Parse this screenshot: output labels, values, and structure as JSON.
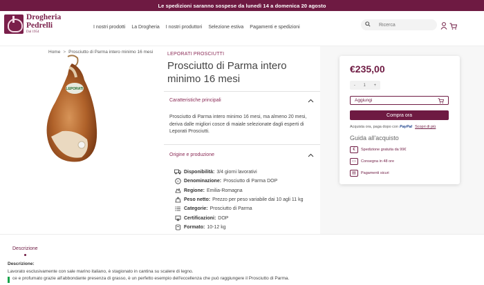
{
  "topbar": {
    "text": "Le spedizioni saranno sospese da lunedì 14 a domenica 20 agosto"
  },
  "logo": {
    "line1": "Drogheria",
    "line2": "Pedrelli",
    "line3": "Dal 1954"
  },
  "nav": {
    "items": [
      "I nostri prodotti",
      "La Drogheria",
      "I nostri produttori",
      "Selezione estiva",
      "Pagamenti e spedizioni"
    ]
  },
  "search": {
    "placeholder": "Ricerca"
  },
  "breadcrumb": {
    "home": "Home",
    "separator": ">",
    "current": "Prosciutto di Parma intero minimo 16 mesi"
  },
  "product": {
    "brand": "LEPORATI PROSCIUTTI",
    "title": "Prosciutto di Parma intero minimo 16 mesi",
    "accordion1_title": "Caratteristiche principali",
    "description": "Prosciutto di Parma intero minimo 16 mesi, ma almeno 20 mesi, deriva dalle migliori cosce di maiale selezionate dagli esperti di Leporati Prosciutti.",
    "accordion2_title": "Origine e produzione",
    "attributes": [
      {
        "label": "Disponibilità:",
        "value": "3/4 giorni lavorativi",
        "icon": "truck-icon"
      },
      {
        "label": "Denominazione:",
        "value": "Prosciutto di Parma DOP",
        "icon": "dop-icon"
      },
      {
        "label": "Regione:",
        "value": "Emilia-Romagna",
        "icon": "region-icon"
      },
      {
        "label": "Peso netto:",
        "value": "Prezzo per peso variabile dai 10 agli 11 kg",
        "icon": "weight-icon"
      },
      {
        "label": "Categorie:",
        "value": "Prosciutto di Parma",
        "icon": "list-icon"
      },
      {
        "label": "Certificazioni:",
        "value": "DOP",
        "icon": "certificate-icon"
      },
      {
        "label": "Formato:",
        "value": "10-12 kg",
        "icon": "format-icon"
      }
    ]
  },
  "purchase": {
    "price": "€235,00",
    "qty_minus": "-",
    "qty_value": "1",
    "qty_plus": "+",
    "add_label": "Aggiungi",
    "buy_label": "Compra ora",
    "paypal_text": "Acquista ora, paga dopo con",
    "paypal_brand": "PayPal",
    "paypal_link": "Scopri di più",
    "guide_title": "Guida all'acquisto",
    "guide_items": [
      "Spedizione gratuita da 99€",
      "Consegna in 48 ore",
      "Pagamenti sicuri"
    ]
  },
  "tabs": {
    "description_tab": "Descrizione"
  },
  "details": {
    "title": "Descrizione:",
    "line1": "Lavorato esclusivamente con sale marino italiano, è stagionato in cantina su scalere di legno.",
    "line2": "ce e profumato grazie all'abbondante presenza di grasso, è un perfetto esempio dell'eccellenza che può raggiungere il Prosciutto di Parma."
  },
  "colors": {
    "brand": "#6e1a42",
    "accent_green": "#17a34a"
  }
}
